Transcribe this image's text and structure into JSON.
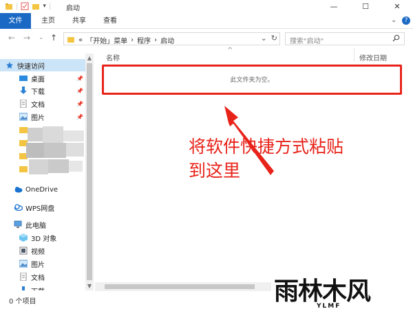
{
  "window": {
    "title": "启动",
    "minimize": "—",
    "maximize": "☐",
    "close": "✕",
    "qat_dropdown": "▾"
  },
  "ribbon": {
    "tabs": [
      "文件",
      "主页",
      "共享",
      "查看"
    ],
    "collapse": "⌄",
    "help": "?"
  },
  "nav": {
    "back": "←",
    "forward": "→",
    "history": "⌄",
    "up": "↑"
  },
  "address": {
    "crumbs_prefix": "«",
    "crumbs": [
      "「开始」菜单",
      "程序",
      "启动"
    ],
    "separator": "›",
    "dropdown": "⌄",
    "refresh": "↻"
  },
  "search": {
    "placeholder": "搜索\"启动\""
  },
  "sidebar": {
    "quick_access": "快速访问",
    "quick_items": [
      "桌面",
      "下载",
      "文档",
      "图片"
    ],
    "pin": "📌",
    "onedrive": "OneDrive",
    "wps": "WPS网盘",
    "this_pc": "此电脑",
    "pc_items": [
      "3D 对象",
      "视频",
      "图片",
      "文档",
      "下载"
    ]
  },
  "content": {
    "col_name": "名称",
    "col_modified": "修改日期",
    "sort_indicator": "^",
    "empty_message": "此文件夹为空。"
  },
  "annotation": {
    "line1": "将软件快捷方式粘贴",
    "line2": "到这里"
  },
  "status": {
    "item_count": "0 个项目"
  },
  "watermark": {
    "text": "雨林木风",
    "sub": "YLMF"
  },
  "colors": {
    "accent": "#1a69c4",
    "highlight": "#e8231a",
    "selected": "#cce4f7"
  }
}
